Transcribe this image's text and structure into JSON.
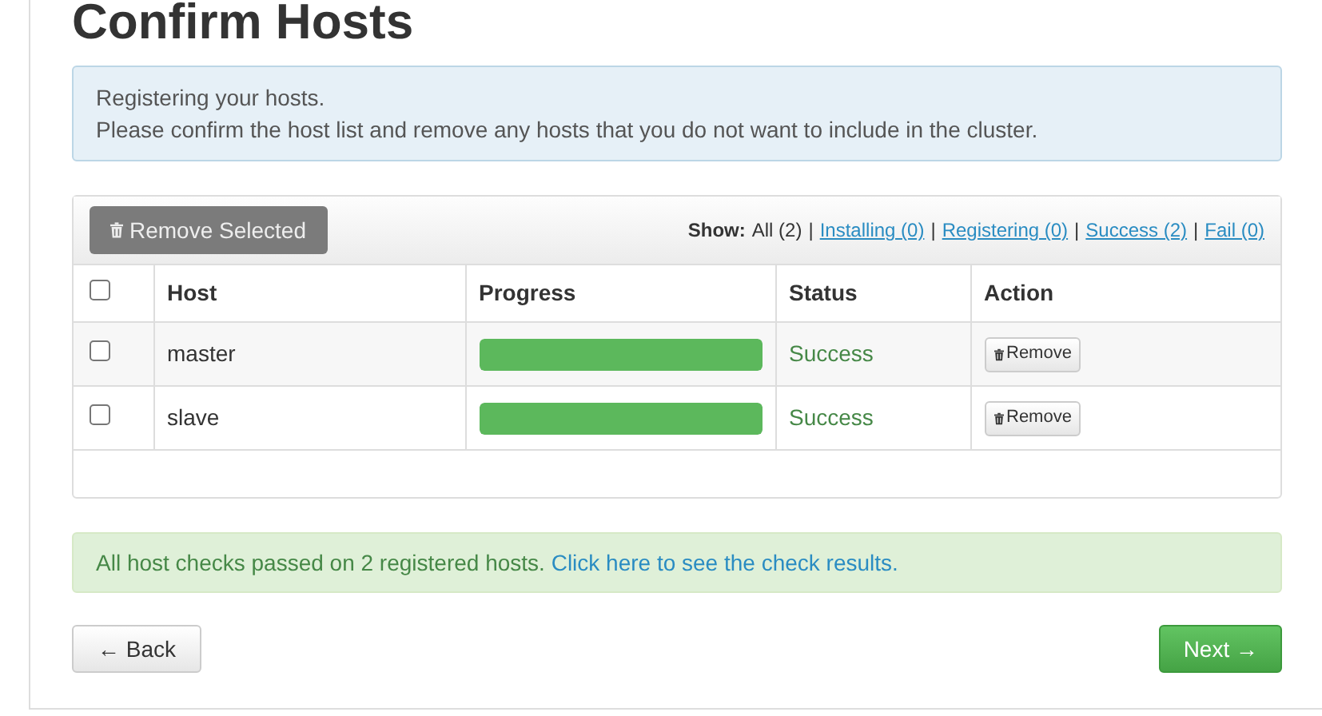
{
  "title": "Confirm Hosts",
  "info": [
    "Registering your hosts.",
    "Please confirm the host list and remove any hosts that you do not want to include in the cluster."
  ],
  "remove_selected": "Remove Selected",
  "filter": {
    "label": "Show:",
    "separator": "|",
    "options": [
      {
        "label": "All (2)",
        "selected": true
      },
      {
        "label": "Installing (0)",
        "selected": false
      },
      {
        "label": "Registering (0)",
        "selected": false
      },
      {
        "label": "Success (2)",
        "selected": false
      },
      {
        "label": "Fail (0)",
        "selected": false
      }
    ]
  },
  "table": {
    "select_all": false,
    "columns": [
      "Host",
      "Progress",
      "Status",
      "Action"
    ],
    "rows": [
      {
        "checked": false,
        "host": "master",
        "level": 1,
        "status": "Success",
        "action": "Remove"
      },
      {
        "checked": false,
        "host": "slave",
        "level": 1,
        "status": "Success",
        "action": "Remove"
      }
    ]
  },
  "alert": {
    "text": "All host checks passed on 2 registered hosts.",
    "link": "Click here to see the check results."
  },
  "back": "← Back",
  "next": "Next →"
}
